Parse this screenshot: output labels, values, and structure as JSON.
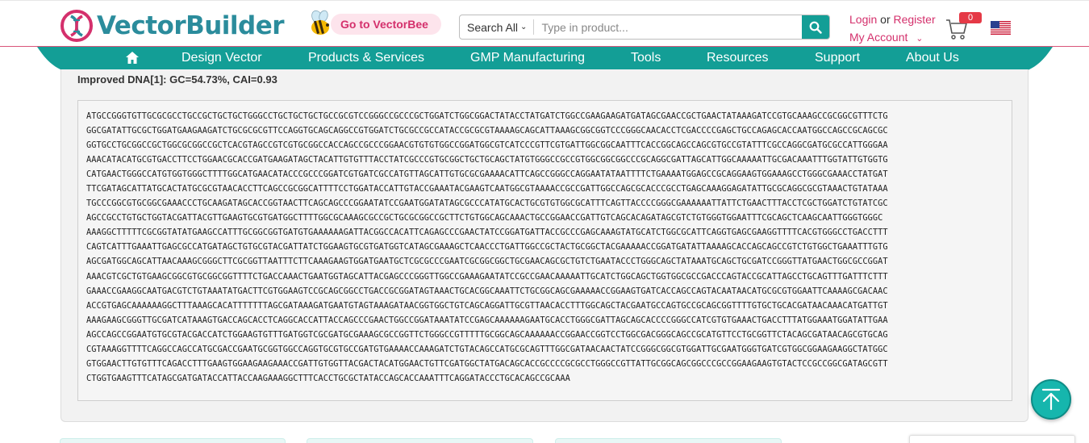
{
  "brand": {
    "name": "VectorBuilder",
    "color": "#2b8c9c",
    "accent": "#d4306c"
  },
  "header": {
    "vectorbee_label": "Go to VectorBee",
    "search": {
      "scope": "Search All",
      "placeholder": "Type in product..."
    },
    "account": {
      "login": "Login",
      "or": "or",
      "register": "Register",
      "my_account": "My Account"
    },
    "cart_count": "0",
    "locale_flag": "us-flag-icon"
  },
  "nav": {
    "color": "#139e96",
    "items": [
      {
        "label": "Design Vector"
      },
      {
        "label": "Products & Services"
      },
      {
        "label": "GMP Manufacturing"
      },
      {
        "label": "Tools"
      },
      {
        "label": "Resources"
      },
      {
        "label": "Support"
      },
      {
        "label": "About Us"
      }
    ]
  },
  "result": {
    "heading": "Improved DNA[1]: GC=54.73%, CAI=0.93",
    "sequence_lines": [
      "ATGCCGGGTGTTGCGCGCCTGCCGCTGCTGCTGGGCCTGCTGCTGCTGCCGCGTCCGGGCCGCCCGCTGGATCTGGCGGACTATACCTATGATCTGGCCGAAGAAGATGATAGCGAACCGCTGAACTATAAAGATCCGTGCAAAGCCGCGGCGTTTCTG",
      "GGCGATATTGCGCTGGATGAAGAAGATCTGCGCGCGTTCCAGGTGCAGCAGGCCGTGGATCTGCGCCGCCATACCGCGCGTAAAAGCAGCATTAAAGCGGCGGTCCCGGGCAACACCTCGACCCCGAGCTGCCAGAGCACCAATGGCCAGCCGCAGCGC",
      "GGTGCCTGCGGCCGCTGGCGCGGCCGCTCACGTAGCCGTCGTGCGGCCACCAGCCGCCCGGAACGTGTGTGGCCGGATGGCGTCATCCCGTTCGTGATTGGCGGCAATTTCACCGGCAGCCAGCGTGCCGTATTTCGCCAGGCGATGCGCCATTGGGAA",
      "AAACATACATGCGTGACCTTCCTGGAACGCACCGATGAAGATAGCTACATTGTGTTTACCTATCGCCCGTGCGGCTGCTGCAGCTATGTGGGCCGCCGTGGCGGCGGCCCGCAGGCGATTAGCATTGGCAAAAATTGCGACAAATTTGGTATTGTGGTG",
      "CATGAACTGGGCCATGTGGTGGGCTTTTGGCATGAACATACCCGCCCGGATCGTGATCGCCATGTTAGCATTGTGCGCGAAAACATTCAGCCGGGCCAGGAATATAATTTTCTGAAAATGGAGCCGCAGGAAGTGGAAAGCCTGGGCGAAACCTATGAT",
      "TTCGATAGCATTATGCACTATGCGCGTAACACCTTCAGCCGCGGCATTTTCCTGGATACCATTGTACCGAAATACGAAGTCAATGGCGTAAAACCGCCGATTGGCCAGCGCACCCGCCTGAGCAAAGGAGATATTGCGCAGGCGCGTAAACTGTATAAA",
      "TGCCCGGCGTGCGGCGAAACCCTGCAAGATAGCACCGGTAACTTCAGCAGCCCGGAATATCCGAATGGATATAGCGCCCATATGCACTGCGTGTGGCGCATTTCAGTTACCCCGGGCGAAAAAATTATTCTGAACTTTACCTCGCTGGATCTGTATCGC",
      "AGCCGCCTGTGCTGGTACGATTACGTTGAAGTGCGTGATGGCTTTTGGCGCAAAGCGCCGCTGCGCGGCCGCTTCTGTGGCAGCAAACTGCCGGAACCGATTGTCAGCACAGATAGCGTCTGTGGGTGGAATTTCGCAGCTCAAGCAATTGGGTGGGC",
      "AAAGGCTTTTTCGCGGTATATGAAGCCATTTGCGGCGGTGATGTGAAAAAAGATTACGGCCACATTCAGAGCCCGAACTATCCGGATGATTACCGCCCGAGCAAAGTATGCATCTGGCGCATTCAGGTGAGCGAAGGTTTTCACGTGGGCCTGACCTTT",
      "CAGTCATTTGAAATTGAGCGCCATGATAGCTGTGCGTACGATTATCTGGAAGTGCGTGATGGTCATAGCGAAAGCTCAACCCTGATTGGCCGCTACTGCGGCTACGAAAAACCGGATGATATTAAAAGCACCAGCAGCCGTCTGTGGCTGAAATTTGTG",
      "AGCGATGGCAGCATTAACAAAGCGGGCTTCGCGGTTAATTTCTTCAAAGAAGTGGATGAATGCTCGCGCCCGAATCGCGGCGGCTGCGAACAGCGCTGTCTGAATACCCTGGGCAGCTATAAATGCAGCTGCGATCCGGGTTATGAACTGGCGCCGGAT",
      "AAACGTCGCTGTGAAGCGGCGTGCGGCGGTTTTCTGACCAAACTGAATGGTAGCATTACGAGCCCGGGTTGGCCGAAAGAATATCCGCCGAACAAAAATTGCATCTGGCAGCTGGTGGCGCCGACCCAGTACCGCATTAGCCTGCAGTTTGATTTCTTT",
      "GAAACCGAAGGCAATGACGTCTGTAAATATGACTTCGTGGAAGTCCGCAGCGGCCTGACCGCGGATAGTAAACTGCACGGCAAATTCTGCGGCAGCGAAAAACCGGAAGTGATCACCAGCCAGTACAATAACATGCGCGTGGAATTCAAAAGCGACAAC",
      "ACCGTGAGCAAAAAAGGCTTTAAAGCACATTTTTTTAGCGATAAAGATGAATGTAGTAAAGATAACGGTGGCTGTCAGCAGGATTGCGTTAACACCTTTGGCAGCTACGAATGCCAGTGCCGCAGCGGTTTTGTGCTGCACGATAACAAACATGATTGT",
      "AAAGAAGCGGGTTGCGATCATAAAGTGACCAGCACCTCAGGCACCATTACCAGCCCGAACTGGCCGGATAAATATCCGAGCAAAAAAGAATGCACCTGGGCGATTAGCAGCACCCCGGGCCATCGTGTGAAACTGACCTTTATGGAAATGGATATTGAA",
      "AGCCAGCCGGAATGTGCGTACGACCATCTGGAAGTGTTTGATGGTCGCGATGCGAAAGCGCCGGTTCTGGGCCGTTTTTGCGGCAGCAAAAAACCGGAACCGGTCCTGGCGACGGGCAGCCGCATGTTCCTGCGGTTCTACAGCGATAACAGCGTGCAG",
      "CGTAAAGGTTTTCAGGCCAGCCATGCGACCGAATGCGGTGGCCAGGTGCGTGCCGATGTGAAAACCAAAGATCTGTACAGCCATGCGCAGTTTGGCGATAACAACTATCCGGGCGGCGTGGATTGCGAATGGGTGATCGTGGCGGAAGAAGGCTATGGC",
      "GTGGAACTTGTGTTTCAGACCTTTGAAGTGGAAGAAGAAACCGATTGTGGTTACGACTACATGGAACTGTTCGATGGCTATGACAGCACCGCCCCGCGCCTGGGCCGTTATTGCGGCAGCGGCCCGCCGGAAGAAGTGTACTCCGCCGGCGATAGCGTT",
      "CTGGTGAAGTTTCATAGCGATGATACCATTACCAAGAAAGGCTTTCACCTGCGCTATACCAGCACCAAATTTCAGGATACCCTGCACAGCCGCAAA"
    ]
  }
}
